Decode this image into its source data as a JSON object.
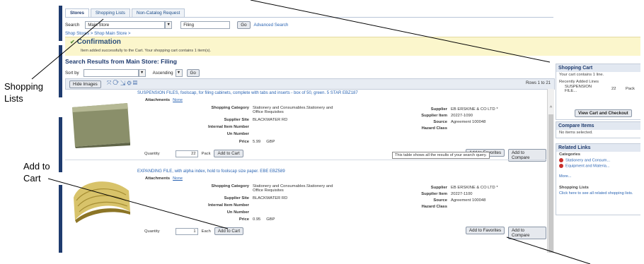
{
  "callouts": {
    "shopping_lists": [
      "Shopping",
      "Lists"
    ],
    "add_to_cart": [
      "Add to",
      "Cart"
    ]
  },
  "tabs": [
    {
      "label": "Stores",
      "active": true
    },
    {
      "label": "Shopping Lists",
      "active": false
    },
    {
      "label": "Non-Catalog Request",
      "active": false
    }
  ],
  "search": {
    "label": "Search",
    "store_value": "Main Store",
    "query_value": "Filing",
    "go_label": "Go",
    "advanced_label": "Advanced Search"
  },
  "breadcrumb": "Shop Stores > Shop Main Store >",
  "confirmation": {
    "title": "Confirmation",
    "message": "Item added successfully to the Cart. Your shopping cart contains 1 item(s)."
  },
  "results_title": "Search Results from Main Store: Filing",
  "sort": {
    "label": "Sort by",
    "order_value": "Ascending",
    "go_label": "Go"
  },
  "toolbar": {
    "hide_images_label": "Hide Images",
    "rows_label": "Rows 1 to 21"
  },
  "labels": {
    "attachments": "Attachments",
    "shopping_category": "Shopping Category",
    "supplier_site": "Supplier Site",
    "internal_item_number": "Internal Item Number",
    "un_number": "Un Number",
    "price": "Price",
    "supplier": "Supplier",
    "supplier_item": "Supplier Item",
    "source": "Source",
    "hazard_class": "Hazard Class",
    "quantity": "Quantity",
    "add_to_cart": "Add to Cart",
    "add_to_favorites": "Add to Favorites",
    "add_to_compare": "Add to Compare"
  },
  "items": [
    {
      "title": "SUSPENSION FILES, foolscap, for filing cabinets, complete with tabs and inserts - box of 50, green. 5 STAR EBZ187",
      "attachments": "None",
      "category_line1": "Stationery and Consumables.Stationery and",
      "category_line2": "Office Requisites",
      "supplier_site": "BLACKWATER RD",
      "price": "5.99",
      "currency": "GBP",
      "supplier": "EB ERSKINE & CO LTD *",
      "supplier_item": "20227-1090",
      "source": "Agreement 100048",
      "quantity": "22",
      "uom": "Pack"
    },
    {
      "title": "EXPANDING FILE, with alpha index, hold to foolscap size paper. EBE EBZ589",
      "attachments": "None",
      "category_line1": "Stationery and Consumables.Stationery and",
      "category_line2": "Office Requisites",
      "supplier_site": "BLACKWATER RD",
      "price": "0.95",
      "currency": "GBP",
      "supplier": "EB ERSKINE & CO LTD *",
      "supplier_item": "20227-1100",
      "source": "Agreement 100048",
      "quantity": "1",
      "uom": "Each"
    }
  ],
  "tooltip": "This table shows all the results of your search query.",
  "cart": {
    "title": "Shopping Cart",
    "status": "Your cart contains 1 line.",
    "recent_label": "Recently Added Lines",
    "line_name_1": "SUSPENSION",
    "line_name_2": "FILE...",
    "line_qty": "22",
    "line_uom": "Pack",
    "checkout_label": "View Cart and Checkout"
  },
  "compare": {
    "title": "Compare Items",
    "status": "No items selected."
  },
  "related": {
    "title": "Related Links",
    "categories_label": "Categories",
    "cat1": "Stationery and Consum...",
    "cat2": "Equipment and Materia...",
    "more": "More...",
    "lists_title": "Shopping Lists",
    "lists_text": "Click here to see all related shopping lists."
  },
  "colors": {
    "nav_bar": "#1f3b6e",
    "confirm_bg": "#fbf6cc",
    "link": "#2a64b3",
    "header_bg": "#e2e8f1"
  }
}
